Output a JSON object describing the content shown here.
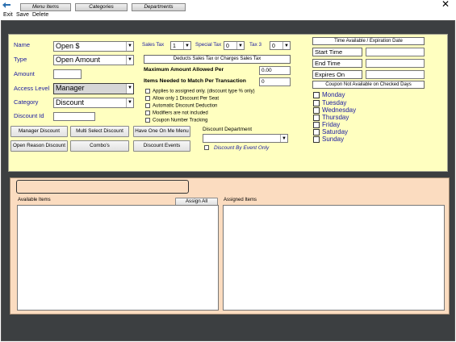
{
  "window": {
    "close_glyph": "✕"
  },
  "menu": [
    "Exit",
    "Save",
    "Delete"
  ],
  "form": {
    "name_label": "Name",
    "name_value": "Open $",
    "type_label": "Type",
    "type_value": "Open Amount",
    "amount_label": "Amount",
    "amount_value": "",
    "access_label": "Access Level",
    "access_value": "Manager",
    "category_label": "Category",
    "category_value": "Discount",
    "discountid_label": "Discount Id",
    "discountid_value": ""
  },
  "tax": {
    "sales_label": "Sales Tax",
    "sales_value": "1",
    "special_label": "Special Tax",
    "special_value": "0",
    "tax3_label": "Tax 3",
    "tax3_value": "0",
    "deducts_label": "Deducts Sales Tax or Charges Sales Tax"
  },
  "limits": {
    "max_label": "Maximum Amount Allowed Per",
    "max_value": "0.00",
    "items_label": "Items Needed to Match Per Transaction",
    "items_value": "0"
  },
  "options": [
    {
      "label": "Applies to assigned only. (discount type % only)",
      "checked": false
    },
    {
      "label": "Allow only 1 Discount Per Seat",
      "checked": false
    },
    {
      "label": "Automatic Discount Deduction",
      "checked": false
    },
    {
      "label": "Modifiers are not included",
      "checked": false
    },
    {
      "label": "Coupon Number Tracking",
      "checked": false
    }
  ],
  "buttons": {
    "manager_discount": "Manager Discount",
    "multi_select": "Multi Select Discount",
    "have_one": "Have One On Me Menu",
    "open_reason": "Open Reason Discount",
    "combos": "Combo's",
    "discount_events": "Discount Events"
  },
  "department": {
    "label": "Discount Department",
    "value": "",
    "by_event_label": "Discount By Event Only",
    "by_event_checked": false
  },
  "time": {
    "header": "Time Available / Expiration Date",
    "start_label": "Start Time",
    "start_value": "",
    "end_label": "End Time",
    "end_value": "",
    "expires_label": "Expires On",
    "expires_value": "",
    "days_header": "Coupon Not Available on Checked Days",
    "days": [
      "Monday",
      "Tuesday",
      "Wednesday",
      "Thursday",
      "Friday",
      "Saturday",
      "Sunday"
    ]
  },
  "tabs": [
    "Menu Items",
    "Categories",
    "Departments"
  ],
  "lists": {
    "available_label": "Available Items",
    "assign_all_label": "Assign All",
    "assigned_label": "Assigned Items"
  }
}
